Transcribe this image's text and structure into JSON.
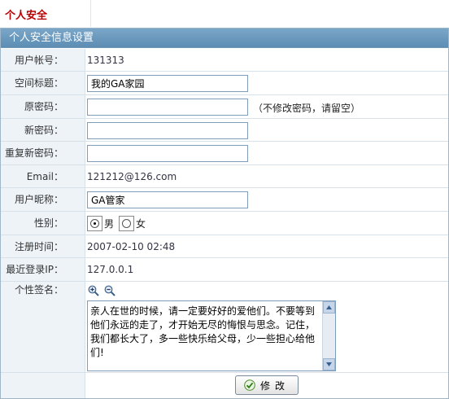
{
  "page": {
    "tab_title": "个人安全",
    "panel_title": "个人安全信息设置"
  },
  "form": {
    "account": {
      "label": "用户帐号：",
      "value": "131313"
    },
    "space_title": {
      "label": "空间标题：",
      "value": "我的GA家园"
    },
    "old_password": {
      "label": "原密码：",
      "value": "",
      "hint": "（不修改密码，请留空）"
    },
    "new_password": {
      "label": "新密码：",
      "value": ""
    },
    "repeat_password": {
      "label": "重复新密码：",
      "value": ""
    },
    "email": {
      "label": "Email：",
      "value": "121212@126.com"
    },
    "nickname": {
      "label": "用户昵称：",
      "value": "GA管家"
    },
    "gender": {
      "label": "性别：",
      "options": [
        "男",
        "女"
      ],
      "selected": "男"
    },
    "register_time": {
      "label": "注册时间：",
      "value": "2007-02-10 02:48"
    },
    "last_login_ip": {
      "label": "最近登录IP：",
      "value": "127.0.0.1"
    },
    "signature": {
      "label": "个性签名：",
      "value": "亲人在世的时候，请一定要好好的爱他们。不要等到他们永远的走了，才开始无尽的悔恨与思念。记住，我们都长大了，多一些快乐给父母，少一些担心给他们!",
      "zoom_in_icon": "zoom-in-icon",
      "zoom_out_icon": "zoom-out-icon"
    }
  },
  "buttons": {
    "submit_label": "修改"
  },
  "colors": {
    "header": "#5d8db4",
    "label_bg": "#eef3f8",
    "tab_title": "#b80000"
  }
}
